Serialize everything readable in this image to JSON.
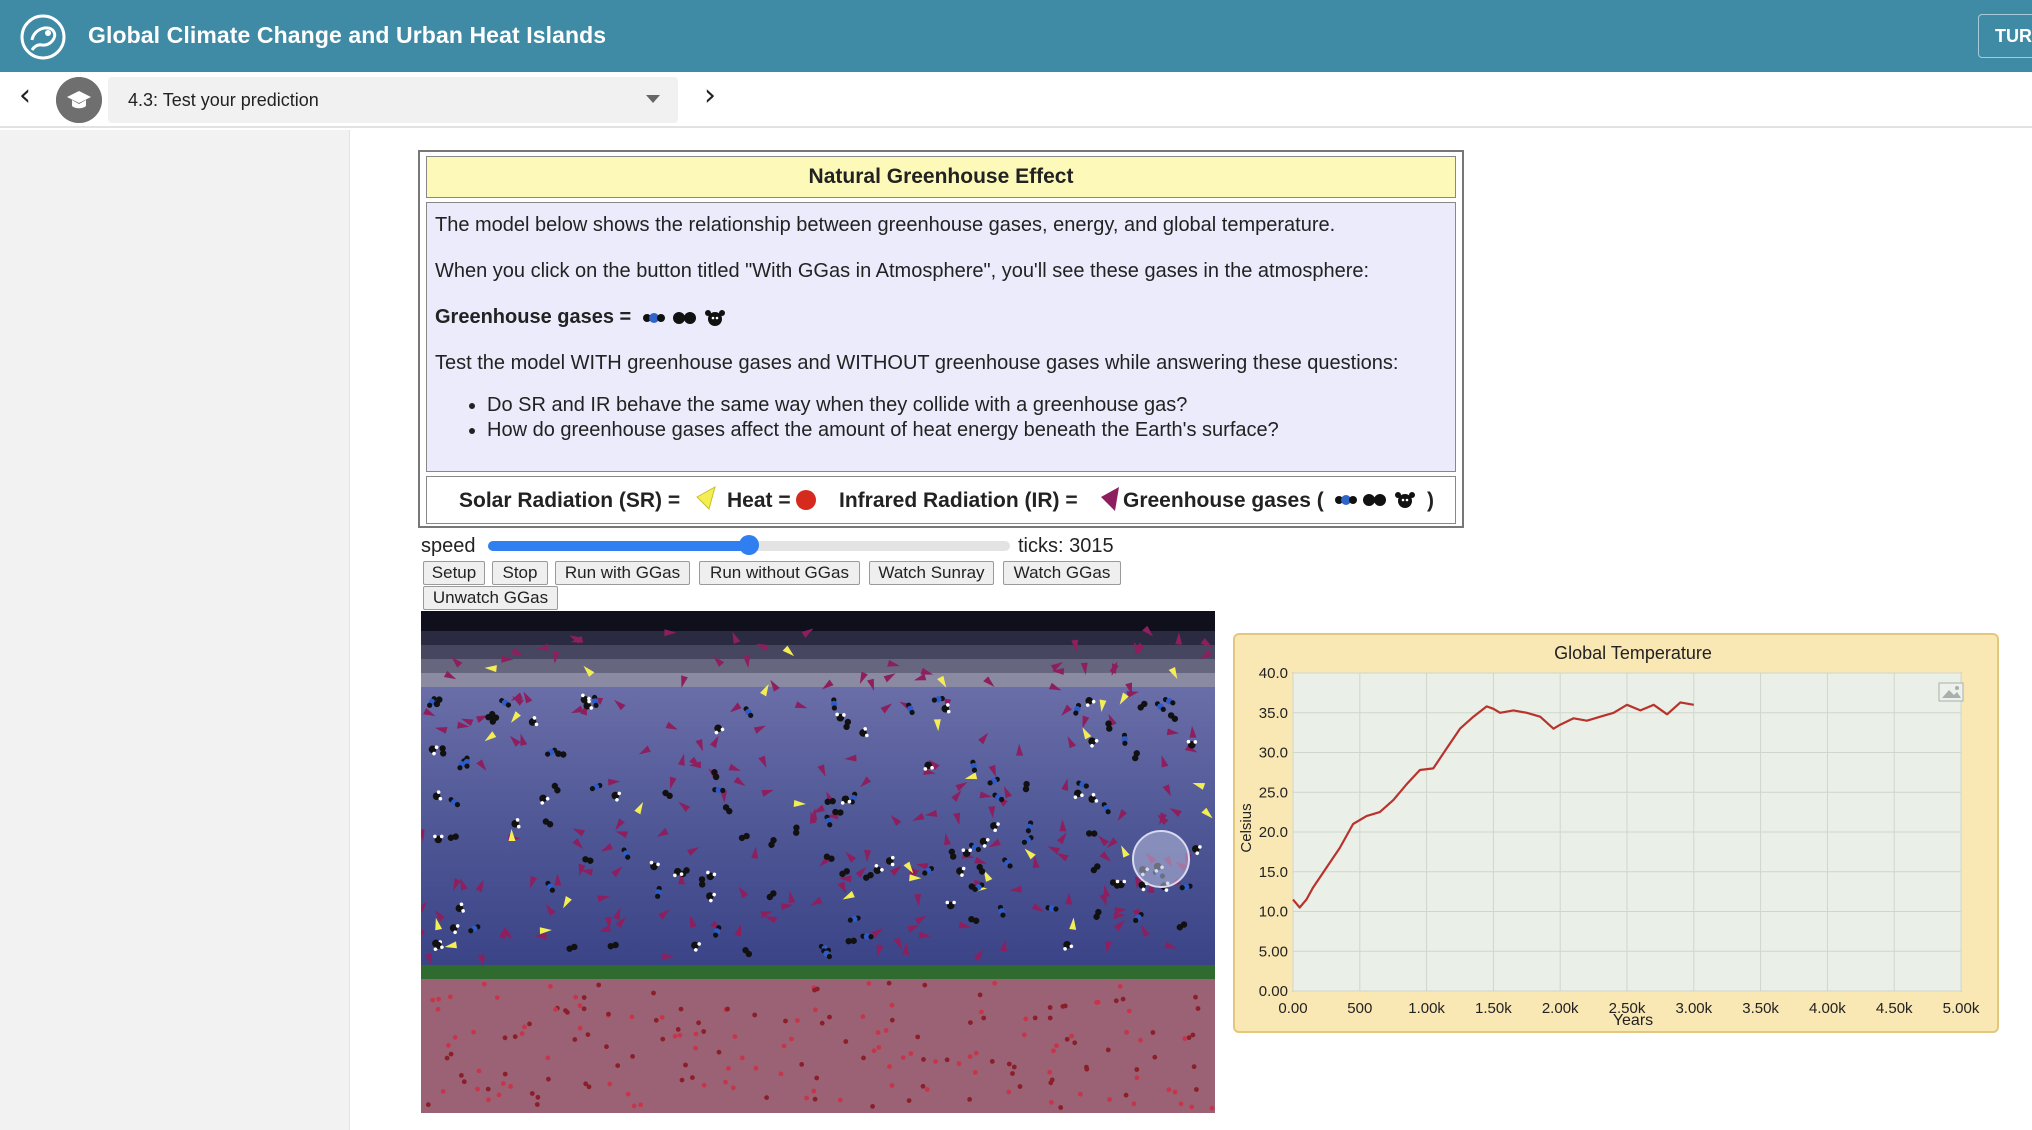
{
  "header": {
    "app_title": "Global Climate Change and Urban Heat Islands",
    "right_button_label": "TUR",
    "logo_icon": "concord-logo-icon",
    "bg_color": "#3f8ba6"
  },
  "navigation": {
    "current_page": "4.3: Test your prediction",
    "prev_icon": "chevron-left-icon",
    "next_icon": "chevron-right-icon"
  },
  "info_box": {
    "title": "Natural Greenhouse Effect",
    "paragraphs": [
      "The model below shows the relationship between greenhouse gases, energy, and global temperature.",
      "When you click on the button titled \"With GGas in Atmosphere\", you'll see these gases in the atmosphere:",
      "Greenhouse gases =",
      "Test the model WITH greenhouse gases and WITHOUT greenhouse gases while answering these questions:"
    ],
    "questions": [
      "Do SR and IR behave the same way when they collide with a greenhouse gas?",
      "How do greenhouse gases affect the amount of heat energy beneath the Earth's surface?"
    ],
    "legend": {
      "solar_label": "Solar Radiation (SR) =",
      "heat_label": "Heat =",
      "infrared_label": "Infrared Radiation (IR) =",
      "ggas_label": "Greenhouse gases (",
      "ggas_close": ")",
      "solar_color": "#f4ee55",
      "heat_color": "#d62a1e",
      "infrared_color": "#8e1f5e"
    },
    "header_color": "#fdfab9",
    "body_color": "#ebebfb"
  },
  "controls": {
    "speed_label": "speed",
    "speed_fraction": 0.5,
    "ticks_text": "ticks: 3015",
    "buttons": {
      "setup": "Setup",
      "stop": "Stop",
      "run_with": "Run with GGas",
      "run_without": "Run without GGas",
      "watch_sunray": "Watch Sunray",
      "watch_ggas": "Watch GGas",
      "unwatch_ggas": "Unwatch GGas"
    }
  },
  "chart_data": {
    "type": "line",
    "title": "Global Temperature",
    "xlabel": "Years",
    "ylabel": "Celsius",
    "xlim": [
      0,
      5000
    ],
    "ylim": [
      0,
      40
    ],
    "x_ticks": [
      "0.00",
      "500",
      "1.00k",
      "1.50k",
      "2.00k",
      "2.50k",
      "3.00k",
      "3.50k",
      "4.00k",
      "4.50k",
      "5.00k"
    ],
    "y_ticks": [
      "0.00",
      "5.00",
      "10.0",
      "15.0",
      "20.0",
      "25.0",
      "30.0",
      "35.0",
      "40.0"
    ],
    "grid": true,
    "series": [
      {
        "color": "#b8332c",
        "x": [
          0,
          50,
          100,
          150,
          250,
          350,
          450,
          550,
          650,
          750,
          850,
          950,
          1050,
          1150,
          1250,
          1350,
          1450,
          1500,
          1550,
          1650,
          1750,
          1850,
          1950,
          2000,
          2100,
          2200,
          2300,
          2400,
          2500,
          2600,
          2700,
          2800,
          2900,
          3000
        ],
        "values": [
          11.5,
          10.5,
          11.5,
          13.0,
          15.5,
          18.0,
          21.0,
          22.0,
          22.5,
          24.0,
          26.0,
          27.8,
          28.0,
          30.5,
          33.0,
          34.5,
          35.8,
          35.5,
          35.0,
          35.3,
          35.0,
          34.5,
          33.0,
          33.5,
          34.3,
          34.0,
          34.5,
          35.0,
          36.0,
          35.3,
          36.0,
          34.8,
          36.3,
          36.0
        ]
      }
    ]
  },
  "graph_icons": {
    "snapshot": "image-icon"
  }
}
